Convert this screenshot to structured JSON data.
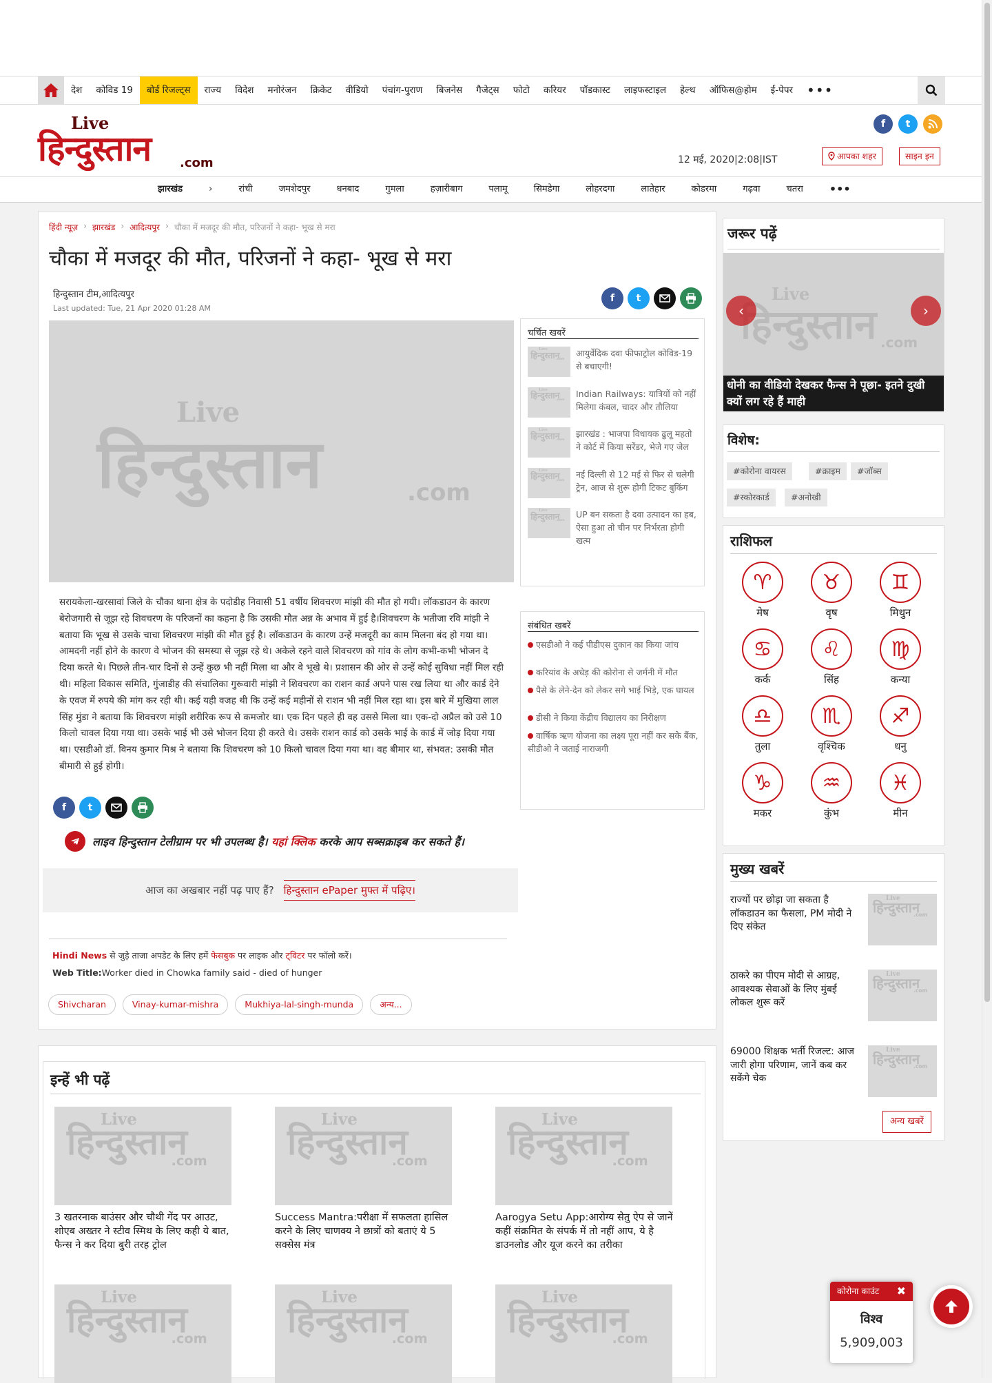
{
  "brand": {
    "live": "Live",
    "name": "हिन्दुस्तान",
    "com": ".com",
    "accent": "#c4161c"
  },
  "topnav": {
    "items": [
      "देश",
      "कोविड 19",
      "बोर्ड रिजल्ट्स",
      "राज्य",
      "विदेश",
      "मनोरंजन",
      "क्रिकेट",
      "वीडियो",
      "पंचांग-पुराण",
      "बिजनेस",
      "गैजेट्स",
      "फोटो",
      "करियर",
      "पॉडकास्ट",
      "लाइफस्टाइल",
      "हेल्थ",
      "ऑफिस@होम",
      "ई-पेपर"
    ],
    "active": "बोर्ड रिजल्ट्स",
    "more": "•••"
  },
  "header": {
    "date": "12 मई, 2020|2:08|IST",
    "city_btn": "आपका शहर",
    "signin_btn": "साइन इन"
  },
  "subnav": {
    "state": "झारखंड",
    "arrow": "›",
    "items": [
      "रांची",
      "जमशेदपुर",
      "धनबाद",
      "गुमला",
      "हज़ारीबाग",
      "पलामू",
      "सिमडेगा",
      "लोहरदगा",
      "लातेहार",
      "कोडरमा",
      "गढ़वा",
      "चतरा"
    ],
    "more": "•••"
  },
  "article": {
    "breadcrumb": [
      "हिंदी न्यूज़",
      "झारखंड",
      "आदित्यपुर",
      "चौका में मजदूर की मौत, परिजनों ने कहा- भूख से मरा"
    ],
    "sep": "›",
    "headline": "चौका में मजदूर की मौत, परिजनों ने कहा- भूख से मरा",
    "author": "हिन्दुस्तान टीम,आदित्यपुर",
    "updated": "Last updated:  Tue, 21 Apr 2020 01:28 AM",
    "body": "सरायकेला-खरसावां जिले के चौका थाना क्षेत्र के पदोडीह निवासी 51 वर्षीय शिवचरण मांझी की मौत हो गयी। लॉकडाउन के कारण बेरोजगारी से जूझ रहे शिवचरण के परिजनों का कहना है कि उसकी मौत अन्न के अभाव में हुई है।शिवचरण के भतीजा रवि मांझी ने बताया कि भूख से उसके चाचा शिवचरण मांझी की मौत हुई है। लॉकडाउन के कारण उन्हें मजदूरी का काम मिलना बंद हो गया था। आमदनी नहीं होने के कारण वे भोजन की समस्या से जूझ रहे थे। अकेले रहने वाले शिवचरण को गांव के लोग कभी-कभी भोजन दे दिया करते थे। पिछले तीन-चार दिनों से उन्हें कुछ भी नहीं मिला था और वे भूखे थे। प्रशासन की ओर से उन्हें कोई सुविधा नहीं मिल रही थी। महिला विकास समिति, गुंजाडीह की संचालिका गुरूवारी मांझी ने शिवचरण का राशन कार्ड अपने पास रख लिया था और कार्ड देने के एवज में रुपये की मांग कर रही थी। कई यही वजह थी कि उन्हें कई महीनों से राशन भी नहीं मिल रहा था। इस बारे में मुखिया लाल सिंह मुंडा ने बताया कि शिवचरण मांझी शरीरिक रूप से कमजोर था। एक दिन पहले ही वह उससे मिला था। एक-दो अप्रैल को उसे 10 किलो चावल दिया गया था। उसके भाई भी उसे भोजन दिया ही करते थे। उसके राशन कार्ड को उसके भाई के कार्ड में जोड़ दिया गया था। एसडीओ डॉ. विनय कुमार मिश्र ने बताया कि शिवचरण को 10 किलो चावल दिया गया था। वह बीमार था, संभवत: उसकी मौत बीमारी से हुई होगी।",
    "telegram_pre": "लाइव हिन्दुस्तान टेलीग्राम पर भी उपलब्ध है। ",
    "telegram_link": "यहां क्लिक",
    "telegram_post": " करके आप सब्सक्राइब कर सकते हैं।",
    "epaper_q": "आज का अखबार नहीं पढ़ पाए हैं?",
    "epaper_link": "हिन्दुस्तान ePaper मुफ्त में पढ़िए।",
    "follow_a": "Hindi News",
    "follow_b": " से जुड़े ताजा अपडेट के लिए हमें ",
    "follow_c": "फेसबुक",
    "follow_d": " पर लाइक और ",
    "follow_e": "ट्विटर",
    "follow_f": " पर फॉलो करें।",
    "webtitle_label": "Web Title:",
    "webtitle": "Worker died in Chowka family said - died of hunger",
    "tags": [
      "Shivcharan",
      "Vinay-kumar-mishra",
      "Mukhiya-lal-singh-munda",
      "अन्य..."
    ]
  },
  "trending": {
    "title": "चर्चित खबरें",
    "items": [
      "आयुर्वेदिक दवा फीफाट्रोल कोविड-19 से बचाएगी!",
      "Indian Railways: यात्रियों को नहीं मिलेगा कंबल, चादर और तौलिया",
      "झारखंड : भाजपा विधायक ढुलू महतो ने कोर्ट में किया सरेंडर, भेजे गए जेल",
      "नई दिल्ली से 12 मई से फिर से चलेगी ट्रेन, आज से शुरू होगी टिकट बुकिंग",
      "UP बन सकता है दवा उत्पादन का हब, ऐसा हुआ तो चीन पर निर्भरता होगी खत्म"
    ]
  },
  "related": {
    "title": "संबंधित खबरें",
    "items": [
      "एसडीओ ने कई पीडीएस दुकान का किया जांच",
      "करियांव के अधेड़ की कोरोना से जर्मनी में मौत",
      "पैसे के लेने-देन को लेकर सगे भाई भिड़े, एक घायल",
      "डीसी ने किया केंद्रीय विद्यालय का निरीक्षण",
      "वार्षिक ऋण योजना का लक्ष्य पूरा नहीं कर सके बैंक, सीडीओ ने जताई नाराजगी"
    ]
  },
  "must_read": {
    "title": "जरूर पढ़ें",
    "caption": "धोनी का वीडियो देखकर फैन्स ने पूछा- इतने दुखी क्यों लग रहे हैं माही",
    "prev": "‹",
    "next": "›"
  },
  "special": {
    "title": "विशेष:",
    "tags": [
      "#कोरोना वायरस",
      "#क्राइम",
      "#जॉब्स",
      "#स्कोरकार्ड",
      "#अनोखी"
    ]
  },
  "rashifal": {
    "title": "राशिफल",
    "signs": [
      {
        "name": "मेष",
        "glyph": "♈"
      },
      {
        "name": "वृष",
        "glyph": "♉"
      },
      {
        "name": "मिथुन",
        "glyph": "♊"
      },
      {
        "name": "कर्क",
        "glyph": "♋"
      },
      {
        "name": "सिंह",
        "glyph": "♌"
      },
      {
        "name": "कन्या",
        "glyph": "♍"
      },
      {
        "name": "तुला",
        "glyph": "♎"
      },
      {
        "name": "वृश्चिक",
        "glyph": "♏"
      },
      {
        "name": "धनु",
        "glyph": "♐"
      },
      {
        "name": "मकर",
        "glyph": "♑"
      },
      {
        "name": "कुंभ",
        "glyph": "♒"
      },
      {
        "name": "मीन",
        "glyph": "♓"
      }
    ]
  },
  "main_news": {
    "title": "मुख्य खबरें",
    "items": [
      "राज्यों पर छोड़ा जा सकता है लॉकडाउन का फैसला, PM मोदी ने दिए संकेत",
      "ठाकरे का पीएम मोदी से आग्रह, आवश्यक सेवाओं के लिए मुंबई लोकल शुरू करें",
      "69000 शिक्षक भर्ती रिजल्ट: आज जारी होगा परिणाम, जानें कब कर सकेंगे चेक"
    ],
    "more_btn": "अन्य खबरें"
  },
  "also_read": {
    "title": "इन्हें भी पढ़ें",
    "items": [
      "3 खतरनाक बाउंसर और चौथी गेंद पर आउट, शोएब अख्तर ने स्टीव स्मिथ के लिए कही ये बात, फैन्स ने कर दिया बुरी तरह ट्रोल",
      "Success Mantra:परीक्षा में सफलता हासिल करने के लिए चाणक्य ने छात्रों को बताएं ये 5 सक्सेस मंत्र",
      "Aarogya Setu App:आरोग्य सेतु ऐप से जानें कहीं संक्रमित के संपर्क में तो नहीं आप, ये है डाउनलोड और यूज करने का तरीका"
    ]
  },
  "corona": {
    "title": "कोरोना काउंट",
    "close": "✖",
    "label": "विश्व",
    "value": "5,909,003"
  },
  "placeholder": {
    "live": "Live",
    "name": "हिन्दुस्तान",
    "com": ".com"
  },
  "icons": {
    "home": "home-icon",
    "search": "search-icon",
    "facebook": "f",
    "twitter": "t",
    "rss": "rss-icon",
    "email": "email-icon",
    "print": "print-icon",
    "location": "location-icon",
    "telegram": "telegram-icon",
    "totop": "arrow-up-icon"
  }
}
